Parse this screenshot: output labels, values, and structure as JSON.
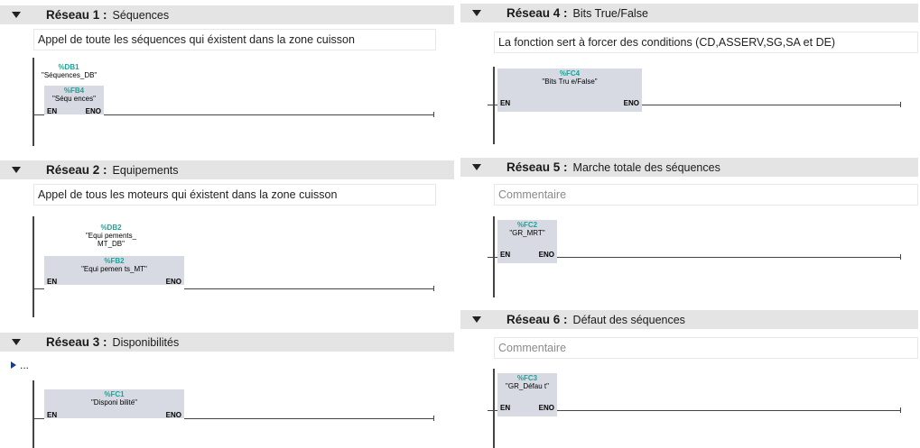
{
  "networks": [
    {
      "title": "Réseau 1 :",
      "name": "Séquences",
      "comment": "Appel de toute les séquences qui éxistent dans la zone cuisson",
      "db_id": "%DB1",
      "db_name": "\"Séquences_DB\"",
      "block_id": "%FB4",
      "block_name": "\"Séqu ences\"",
      "pin_en": "EN",
      "pin_eno": "ENO"
    },
    {
      "title": "Réseau 2 :",
      "name": "Equipements",
      "comment": "Appel de tous les moteurs qui éxistent dans la zone cuisson",
      "db_id": "%DB2",
      "db_name_line1": "\"Equi pements_",
      "db_name_line2": "MT_DB\"",
      "block_id": "%FB2",
      "block_name": "\"Equi pemen ts_MT\"",
      "pin_en": "EN",
      "pin_eno": "ENO"
    },
    {
      "title": "Réseau 3 :",
      "name": "Disponibilités",
      "comment_collapsed": "...",
      "block_id": "%FC1",
      "block_name": "\"Disponi bilité\"",
      "pin_en": "EN",
      "pin_eno": "ENO"
    },
    {
      "title": "Réseau 4 :",
      "name": "Bits True/False",
      "comment": "La fonction sert à forcer des conditions (CD,ASSERV,SG,SA et DE)",
      "block_id": "%FC4",
      "block_name": "\"Bits Tru e/False\"",
      "pin_en": "EN",
      "pin_eno": "ENO"
    },
    {
      "title": "Réseau 5 :",
      "name": "Marche totale des séquences",
      "comment_placeholder": "Commentaire",
      "block_id": "%FC2",
      "block_name": "\"GR_MRT\"",
      "pin_en": "EN",
      "pin_eno": "ENO"
    },
    {
      "title": "Réseau 6 :",
      "name": "Défaut des séquences",
      "comment_placeholder": "Commentaire",
      "block_id": "%FC3",
      "block_name": "\"GR_Défau t\"",
      "pin_en": "EN",
      "pin_eno": "ENO"
    }
  ],
  "colors": {
    "header_bg": "#e4e4e4",
    "block_bg": "#d7dae3",
    "instance_id": "#1aa398",
    "expand_arrow": "#1e3a8a"
  },
  "icons": {
    "collapse": "triangle-down-icon",
    "expand": "triangle-right-icon"
  }
}
